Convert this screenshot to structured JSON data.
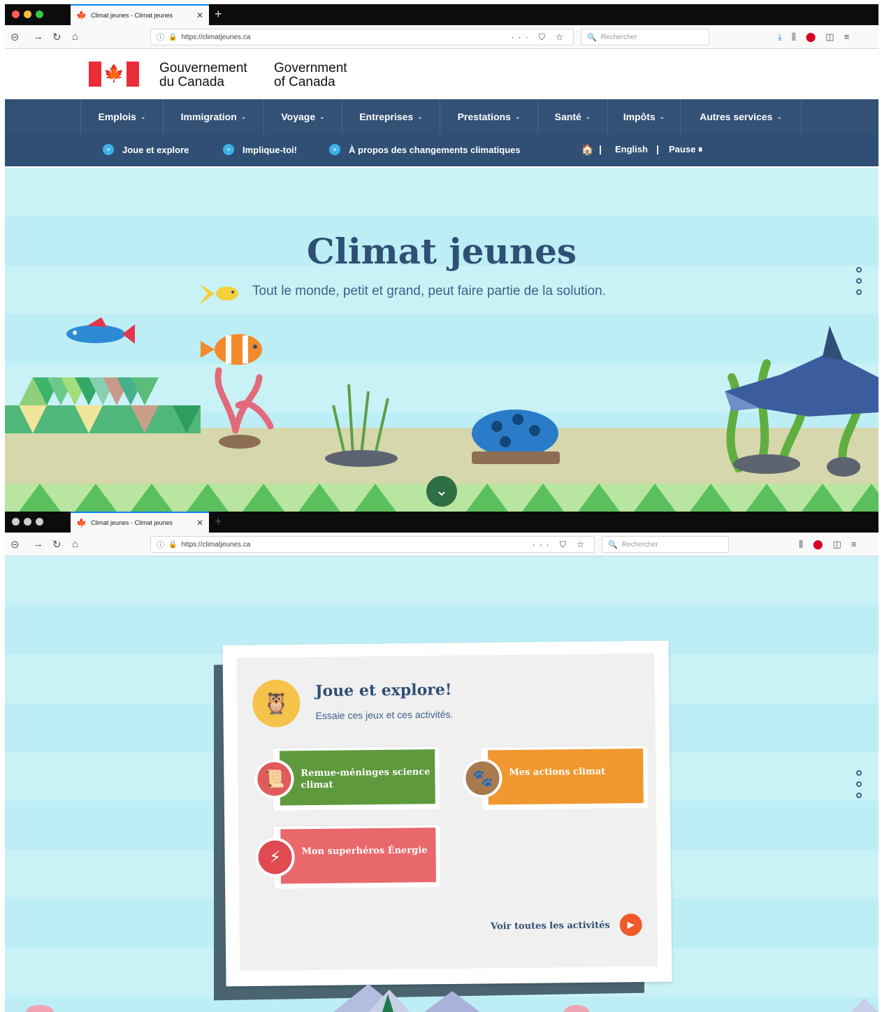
{
  "browser": {
    "tab_title": "Climat jeunes - Climat jeunes",
    "tab_close": "✕",
    "new_tab": "+",
    "url": "https://climatjeunes.ca",
    "page_actions": "··· ⛉ ☆",
    "search_placeholder": "Rechercher",
    "search_icon": "🔍"
  },
  "gc_header": {
    "fr_line1": "Gouvernement",
    "fr_line2": "du Canada",
    "en_line1": "Government",
    "en_line2": "of Canada"
  },
  "menu": {
    "items": [
      {
        "label": "Emplois"
      },
      {
        "label": "Immigration"
      },
      {
        "label": "Voyage"
      },
      {
        "label": "Entreprises"
      },
      {
        "label": "Prestations"
      },
      {
        "label": "Santé"
      },
      {
        "label": "Impôts"
      },
      {
        "label": "Autres services"
      }
    ]
  },
  "subnav": {
    "joue": "Joue et explore",
    "implique": "Implique-toi!",
    "apropos": "À propos des changements climatiques",
    "home_icon": "home-icon",
    "english": "English",
    "pause": "Pause ⏸"
  },
  "hero": {
    "title": "Climat jeunes",
    "subtitle": "Tout le monde, petit et grand, peut faire partie de la solution."
  },
  "card": {
    "title": "Joue et explore!",
    "subtitle": "Essaie ces jeux et ces activités.",
    "activities": [
      {
        "label": "Remue-méninges science climat",
        "color": "#5e9a3d",
        "icon": "certificate-icon"
      },
      {
        "label": "Mes actions climat",
        "color": "#f0982f",
        "icon": "paw-icon"
      },
      {
        "label": "Mon superhéros Énergie",
        "color": "#e8686b",
        "icon": "lightning-icon"
      }
    ],
    "see_all": "Voir toutes les activités"
  },
  "colors": {
    "gc_blue": "#335075",
    "flag_red": "#eb2d37",
    "hero_blue": "#2f4f74",
    "sky": "#c9f2f7"
  }
}
